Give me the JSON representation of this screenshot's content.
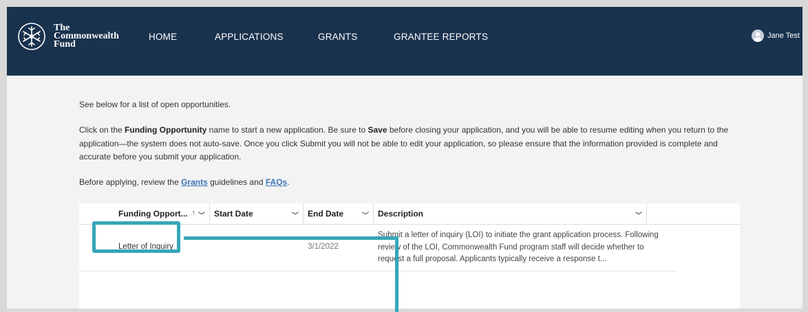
{
  "header": {
    "logo_lines": [
      "The",
      "Commonwealth",
      "Fund"
    ],
    "nav": [
      "HOME",
      "APPLICATIONS",
      "GRANTS",
      "GRANTEE REPORTS"
    ],
    "user_name": "Jane Test",
    "bg_color": "#19324e"
  },
  "intro": {
    "line1": "See below for a list of open opportunities.",
    "p2_a": "Click on the ",
    "p2_b": "Funding Opportunity",
    "p2_c": " name to start a new application. Be sure to ",
    "p2_d": "Save",
    "p2_e": " before closing your application, and you will be able to resume editing when you return to the application—the system does not auto-save. Once you click Submit you will not be able to edit your application, so please ensure that the information provided is complete and accurate before you submit your application.",
    "p3_a": "Before applying, review the ",
    "p3_link1": "Grants",
    "p3_b": " guidelines and ",
    "p3_link2": "FAQs",
    "p3_c": "."
  },
  "table": {
    "columns": [
      "Funding Opport...",
      "Start Date",
      "End Date",
      "Description"
    ],
    "sort_icon": "arrow-up",
    "rows": [
      {
        "num": "1",
        "name": "Letter of Inquiry",
        "start": "",
        "end": "3/1/2022",
        "description": "Submit a letter of inquiry (LOI) to initiate the grant application process. Following review of the LOI, Commonwealth Fund program staff will decide whether to request a full proposal. Applicants typically receive a response t..."
      }
    ]
  },
  "annotation": {
    "color": "#35a7b8"
  }
}
